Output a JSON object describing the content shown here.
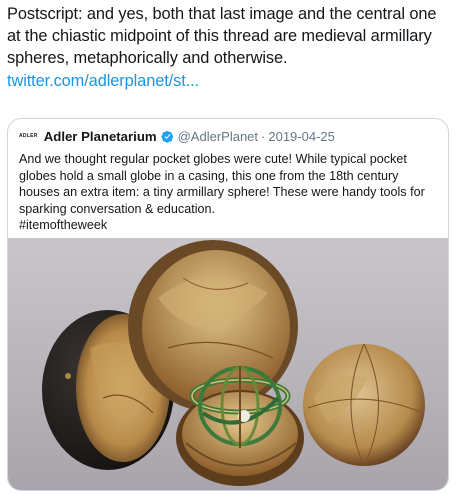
{
  "post": {
    "text": "Postscript: and yes, both that last image and the central one at the chiastic midpoint of this thread are medieval armillary spheres, metaphorically and otherwise.",
    "link": "twitter.com/adlerplanet/st..."
  },
  "quoted": {
    "logo_text": "ADLER",
    "name": "Adler Planetarium",
    "handle": "@AdlerPlanet",
    "separator": "·",
    "date": "2019-04-25",
    "body": "And we thought regular pocket globes were cute! While typical pocket globes hold a small globe in a casing, this one from the 18th century houses an extra item: a tiny armillary sphere! These were handy tools for sparking conversation & education.",
    "hashtag": "#itemoftheweek"
  },
  "colors": {
    "link": "#1b95e0",
    "verified": "#1da1f2",
    "muted": "#657786",
    "border": "#ccd6dd"
  }
}
